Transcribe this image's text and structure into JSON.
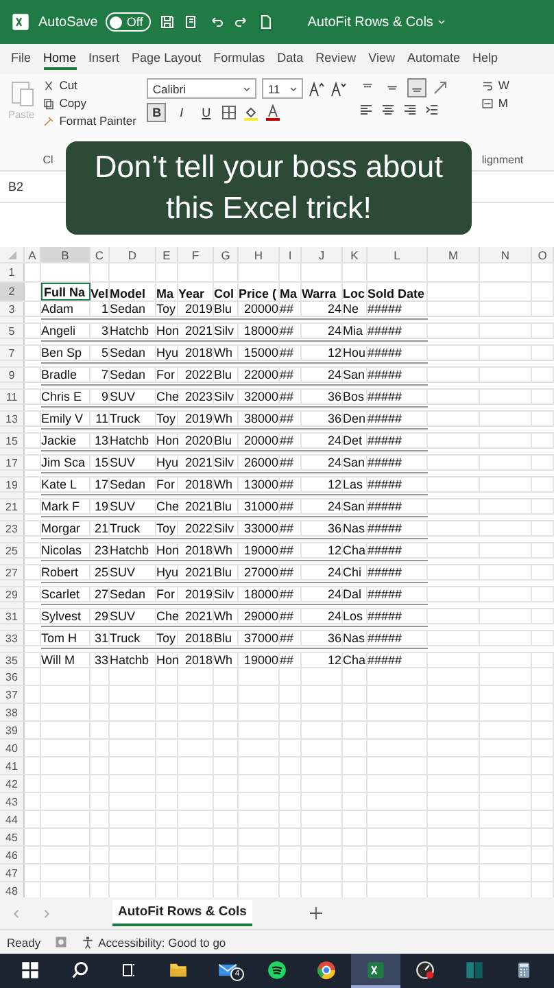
{
  "title_bar": {
    "autosave": {
      "label": "AutoSave",
      "state": "Off",
      "on": false
    },
    "document_title": "AutoFit Rows & Cols"
  },
  "menu_tabs": [
    {
      "label": "File",
      "selected": false
    },
    {
      "label": "Home",
      "selected": true
    },
    {
      "label": "Insert",
      "selected": false
    },
    {
      "label": "Page Layout",
      "selected": false
    },
    {
      "label": "Formulas",
      "selected": false
    },
    {
      "label": "Data",
      "selected": false
    },
    {
      "label": "Review",
      "selected": false
    },
    {
      "label": "View",
      "selected": false
    },
    {
      "label": "Automate",
      "selected": false
    },
    {
      "label": "Help",
      "selected": false
    }
  ],
  "ribbon": {
    "paste": {
      "label": "Paste",
      "disabled": true
    },
    "clipboard": [
      "Cut",
      "Copy",
      "Format Painter"
    ],
    "clipboard_group": "Cl",
    "font_name": "Calibri",
    "font_size": "11",
    "font_buttons": [
      {
        "label": "B",
        "selected": true
      },
      {
        "label": "I",
        "selected": false
      },
      {
        "label": "U",
        "selected": false
      }
    ],
    "alignment": [
      {
        "kind": "top",
        "selected": false
      },
      {
        "kind": "middle",
        "selected": false
      },
      {
        "kind": "bottom",
        "selected": true
      }
    ],
    "wrap": "W",
    "merge": "M",
    "alignment_group": "lignment"
  },
  "caption": {
    "lines": [
      "Don’t tell your boss about",
      "this Excel trick!"
    ]
  },
  "name_box": "B2",
  "sheet": {
    "columns": [
      {
        "label": "A",
        "selected": false
      },
      {
        "label": "B",
        "selected": true
      },
      {
        "label": "C",
        "selected": false
      },
      {
        "label": "D",
        "selected": false
      },
      {
        "label": "E",
        "selected": false
      },
      {
        "label": "F",
        "selected": false
      },
      {
        "label": "G",
        "selected": false
      },
      {
        "label": "H",
        "selected": false
      },
      {
        "label": "I",
        "selected": false
      },
      {
        "label": "J",
        "selected": false
      },
      {
        "label": "K",
        "selected": false
      },
      {
        "label": "L",
        "selected": false
      },
      {
        "label": "M",
        "selected": false
      },
      {
        "label": "N",
        "selected": false
      },
      {
        "label": "O",
        "selected": false
      }
    ],
    "rows": [
      {
        "kind": "empty",
        "number": "1",
        "selected": false
      },
      {
        "kind": "header",
        "number": "2",
        "selected": true,
        "cells": [
          "Full Na",
          "Vel",
          "Model",
          "Ma",
          "Year",
          "Col",
          "Price (",
          "Ma",
          "Warra",
          "Loc",
          "Sold Date"
        ]
      },
      {
        "kind": "data",
        "number": "3",
        "selected": false,
        "cells": [
          "Adam",
          "1",
          "Sedan",
          "Toy",
          "2019",
          "Blu",
          "20000",
          "##",
          "24",
          "Ne",
          "#####"
        ]
      },
      {
        "kind": "squished",
        "selected": false
      },
      {
        "kind": "data",
        "number": "5",
        "selected": false,
        "cells": [
          "Angeli",
          "3",
          "Hatchb",
          "Hon",
          "2021",
          "Silv",
          "18000",
          "##",
          "24",
          "Mia",
          "#####"
        ]
      },
      {
        "kind": "squished",
        "selected": false
      },
      {
        "kind": "data",
        "number": "7",
        "selected": false,
        "cells": [
          "Ben Sp",
          "5",
          "Sedan",
          "Hyu",
          "2018",
          "Wh",
          "15000",
          "##",
          "12",
          "Hou",
          "#####"
        ]
      },
      {
        "kind": "squished",
        "selected": false
      },
      {
        "kind": "data",
        "number": "9",
        "selected": false,
        "cells": [
          "Bradle",
          "7",
          "Sedan",
          "For",
          "2022",
          "Blu",
          "22000",
          "##",
          "24",
          "San",
          "#####"
        ]
      },
      {
        "kind": "squished",
        "selected": false
      },
      {
        "kind": "data",
        "number": "11",
        "selected": false,
        "cells": [
          "Chris E",
          "9",
          "SUV",
          "Che",
          "2023",
          "Silv",
          "32000",
          "##",
          "36",
          "Bos",
          "#####"
        ]
      },
      {
        "kind": "squished",
        "selected": false
      },
      {
        "kind": "data",
        "number": "13",
        "selected": false,
        "cells": [
          "Emily V",
          "11",
          "Truck",
          "Toy",
          "2019",
          "Wh",
          "38000",
          "##",
          "36",
          "Den",
          "#####"
        ]
      },
      {
        "kind": "squished",
        "selected": false
      },
      {
        "kind": "data",
        "number": "15",
        "selected": false,
        "cells": [
          "Jackie",
          "13",
          "Hatchb",
          "Hon",
          "2020",
          "Blu",
          "20000",
          "##",
          "24",
          "Det",
          "#####"
        ]
      },
      {
        "kind": "squished",
        "selected": false
      },
      {
        "kind": "data",
        "number": "17",
        "selected": false,
        "cells": [
          "Jim Sca",
          "15",
          "SUV",
          "Hyu",
          "2021",
          "Silv",
          "26000",
          "##",
          "24",
          "San",
          "#####"
        ]
      },
      {
        "kind": "squished",
        "selected": false
      },
      {
        "kind": "data",
        "number": "19",
        "selected": false,
        "cells": [
          "Kate L",
          "17",
          "Sedan",
          "For",
          "2018",
          "Wh",
          "13000",
          "##",
          "12",
          "Las",
          "#####"
        ]
      },
      {
        "kind": "squished",
        "selected": false
      },
      {
        "kind": "data",
        "number": "21",
        "selected": false,
        "cells": [
          "Mark F",
          "19",
          "SUV",
          "Che",
          "2021",
          "Blu",
          "31000",
          "##",
          "24",
          "San",
          "#####"
        ]
      },
      {
        "kind": "squished",
        "selected": false
      },
      {
        "kind": "data",
        "number": "23",
        "selected": false,
        "cells": [
          "Morgar",
          "21",
          "Truck",
          "Toy",
          "2022",
          "Silv",
          "33000",
          "##",
          "36",
          "Nas",
          "#####"
        ]
      },
      {
        "kind": "squished",
        "selected": false
      },
      {
        "kind": "data",
        "number": "25",
        "selected": false,
        "cells": [
          "Nicolas",
          "23",
          "Hatchb",
          "Hon",
          "2018",
          "Wh",
          "19000",
          "##",
          "12",
          "Cha",
          "#####"
        ]
      },
      {
        "kind": "squished",
        "selected": false
      },
      {
        "kind": "data",
        "number": "27",
        "selected": false,
        "cells": [
          "Robert",
          "25",
          "SUV",
          "Hyu",
          "2021",
          "Blu",
          "27000",
          "##",
          "24",
          "Chi",
          "#####"
        ]
      },
      {
        "kind": "squished",
        "selected": false
      },
      {
        "kind": "data",
        "number": "29",
        "selected": false,
        "cells": [
          "Scarlet",
          "27",
          "Sedan",
          "For",
          "2019",
          "Silv",
          "18000",
          "##",
          "24",
          "Dal",
          "#####"
        ]
      },
      {
        "kind": "squished",
        "selected": false
      },
      {
        "kind": "data",
        "number": "31",
        "selected": false,
        "cells": [
          "Sylvest",
          "29",
          "SUV",
          "Che",
          "2021",
          "Wh",
          "29000",
          "##",
          "24",
          "Los",
          "#####"
        ]
      },
      {
        "kind": "squished",
        "selected": false
      },
      {
        "kind": "data",
        "number": "33",
        "selected": false,
        "cells": [
          "Tom H",
          "31",
          "Truck",
          "Toy",
          "2018",
          "Blu",
          "37000",
          "##",
          "36",
          "Nas",
          "#####"
        ]
      },
      {
        "kind": "squished",
        "selected": false
      },
      {
        "kind": "data",
        "number": "35",
        "selected": false,
        "cells": [
          "Will M",
          "33",
          "Hatchb",
          "Hon",
          "2018",
          "Wh",
          "19000",
          "##",
          "12",
          "Cha",
          "#####"
        ]
      },
      {
        "kind": "empty",
        "number": "36",
        "selected": false
      },
      {
        "kind": "empty",
        "number": "37",
        "selected": false
      },
      {
        "kind": "empty",
        "number": "38",
        "selected": false
      },
      {
        "kind": "empty",
        "number": "39",
        "selected": false
      },
      {
        "kind": "empty",
        "number": "40",
        "selected": false
      },
      {
        "kind": "empty",
        "number": "41",
        "selected": false
      },
      {
        "kind": "empty",
        "number": "42",
        "selected": false
      },
      {
        "kind": "empty",
        "number": "43",
        "selected": false
      },
      {
        "kind": "empty",
        "number": "44",
        "selected": false
      },
      {
        "kind": "empty",
        "number": "45",
        "selected": false
      },
      {
        "kind": "empty",
        "number": "46",
        "selected": false
      },
      {
        "kind": "empty",
        "number": "47",
        "selected": false
      },
      {
        "kind": "empty",
        "number": "48",
        "selected": false
      }
    ]
  },
  "sheet_tabs": [
    {
      "label": "AutoFit Rows & Cols",
      "selected": true
    }
  ],
  "status_bar": {
    "state": "Ready",
    "accessibility": "Accessibility: Good to go"
  },
  "taskbar": {
    "mail_badge": "4",
    "items": [
      {
        "kind": "start",
        "selected": false
      },
      {
        "kind": "search",
        "selected": false
      },
      {
        "kind": "taskview",
        "selected": false
      },
      {
        "kind": "files",
        "selected": false
      },
      {
        "kind": "mail",
        "selected": false
      },
      {
        "kind": "music",
        "selected": false
      },
      {
        "kind": "browser",
        "selected": false
      },
      {
        "kind": "excel",
        "selected": true
      },
      {
        "kind": "gauge",
        "selected": false
      },
      {
        "kind": "book",
        "selected": false
      },
      {
        "kind": "calculator",
        "selected": false
      }
    ]
  }
}
